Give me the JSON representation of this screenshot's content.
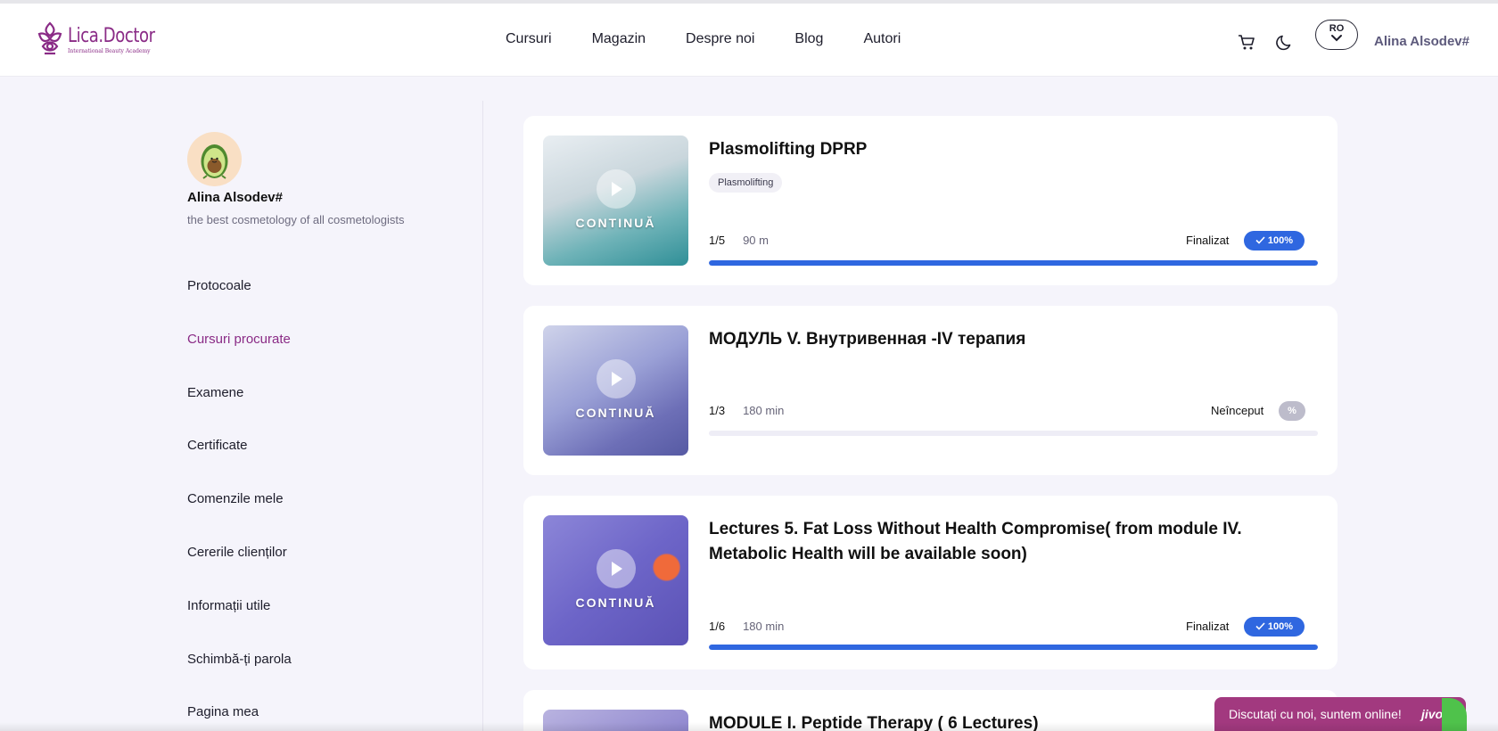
{
  "header": {
    "logo": {
      "name": "Lica.Doctor",
      "subtitle": "International Beauty Academy",
      "icon": "lotus-knot-logo-icon"
    },
    "nav": [
      "Cursuri",
      "Magazin",
      "Despre noi",
      "Blog",
      "Autori"
    ],
    "cart_icon": "cart-icon",
    "theme_icon": "moon-icon",
    "language": "RO",
    "user": "Alina Alsodev#"
  },
  "sidebar": {
    "profile": {
      "name": "Alina Alsodev#",
      "subtitle": "the best cosmetology of all cosmetologists",
      "avatar_icon": "avocado-avatar-icon"
    },
    "menu": [
      "Protocoale",
      "Cursuri procurate",
      "Examene",
      "Certificate",
      "Comenzile mele",
      "Cererile clienților",
      "Informații utile",
      "Schimbă-ți parola",
      "Pagina mea"
    ],
    "active_index": 1
  },
  "courses": [
    {
      "title": "Plasmolifting DPRP",
      "tag": "Plasmolifting",
      "lessons": "1/5",
      "duration": "90 m",
      "status": "Finalizat",
      "badge": "100%",
      "progress": 1.0,
      "thumb_label": "CONTINUĂ"
    },
    {
      "title": "МОДУЛЬ V. Внутривенная -IV терапия",
      "tag": "",
      "lessons": "1/3",
      "duration": "180 min",
      "status": "Neînceput",
      "badge": "%",
      "progress": 0.0,
      "thumb_label": "CONTINUĂ"
    },
    {
      "title": "Lectures 5. Fat Loss Without Health Compromise( from module IV. Metabolic Health will be available soon)",
      "tag": "",
      "lessons": "1/6",
      "duration": "180 min",
      "status": "Finalizat",
      "badge": "100%",
      "progress": 1.0,
      "thumb_label": "CONTINUĂ"
    },
    {
      "title": "MODULE I. Peptide Therapy ( 6 Lectures)",
      "tag": "",
      "lessons": "",
      "duration": "",
      "status": "",
      "badge": "",
      "progress": null,
      "thumb_label": ""
    }
  ],
  "chat": {
    "text": "Discutați cu noi, suntem online!",
    "brand": "jivo"
  },
  "colors": {
    "accent": "#8a2b86",
    "progress": "#2f67e0",
    "background": "#f5f4fb",
    "chat": "#a2397f"
  }
}
